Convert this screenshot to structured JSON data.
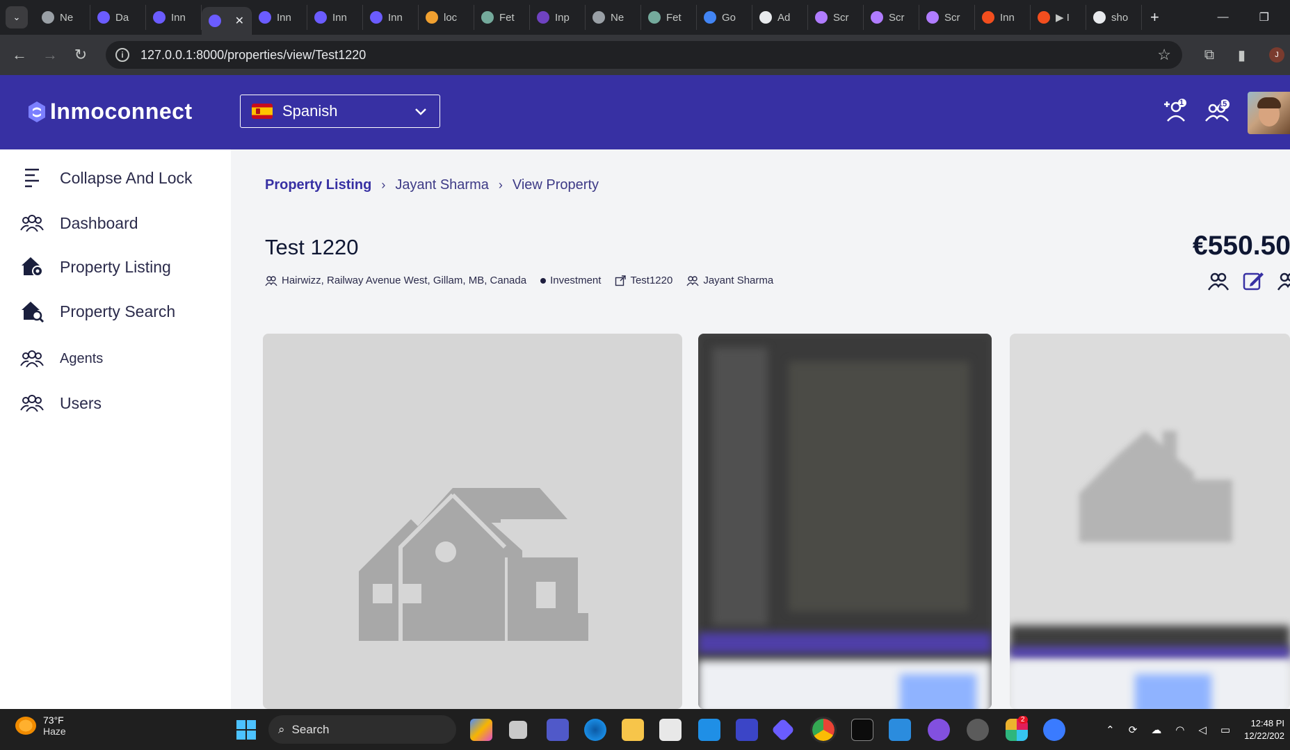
{
  "browser": {
    "tabs": [
      {
        "label": "Ne",
        "color": "#9aa0a6"
      },
      {
        "label": "Da",
        "color": "#6b5cff"
      },
      {
        "label": "Inn",
        "color": "#6b5cff"
      },
      {
        "label": "",
        "color": "#6b5cff",
        "active": true
      },
      {
        "label": "Inn",
        "color": "#6b5cff"
      },
      {
        "label": "Inn",
        "color": "#6b5cff"
      },
      {
        "label": "Inn",
        "color": "#6b5cff"
      },
      {
        "label": "loc",
        "color": "#f0a030"
      },
      {
        "label": "Fet",
        "color": "#74aa9c"
      },
      {
        "label": "Inp",
        "color": "#6f42c1"
      },
      {
        "label": "Ne",
        "color": "#9aa0a6"
      },
      {
        "label": "Fet",
        "color": "#74aa9c"
      },
      {
        "label": "Go",
        "color": "#4285f4"
      },
      {
        "label": "Ad",
        "color": "#e8eaed"
      },
      {
        "label": "Scr",
        "color": "#b07cff"
      },
      {
        "label": "Scr",
        "color": "#b07cff"
      },
      {
        "label": "Scr",
        "color": "#b07cff"
      },
      {
        "label": "Inn",
        "color": "#f24e1e"
      },
      {
        "label": "▶ I",
        "color": "#f24e1e"
      },
      {
        "label": "sho",
        "color": "#e8eaed"
      }
    ],
    "url": "127.0.0.1:8000/properties/view/Test1220",
    "profile_initial": "J"
  },
  "header": {
    "brand": "Inmoconnect",
    "language": "Spanish",
    "agents_badge": "1",
    "team_badge": "15"
  },
  "sidebar": {
    "items": [
      {
        "label": "Collapse And Lock",
        "icon": "collapse-icon"
      },
      {
        "label": "Dashboard",
        "icon": "users-icon"
      },
      {
        "label": "Property Listing",
        "icon": "house-gear-icon"
      },
      {
        "label": "Property Search",
        "icon": "house-search-icon"
      },
      {
        "label": "Agents",
        "icon": "users-icon"
      },
      {
        "label": "Users",
        "icon": "users-icon"
      }
    ]
  },
  "breadcrumb": {
    "items": [
      "Property Listing",
      "Jayant Sharma",
      "View Property"
    ]
  },
  "property": {
    "title": "Test 1220",
    "price": "€550.50",
    "address": "Hairwizz, Railway Avenue West, Gillam, MB, Canada",
    "type": "Investment",
    "reference": "Test1220",
    "agent": "Jayant Sharma"
  },
  "taskbar": {
    "weather_temp": "73°F",
    "weather_desc": "Haze",
    "search_label": "Search",
    "notification_badge": "2",
    "time": "12:48 PI",
    "date": "12/22/202"
  },
  "colors": {
    "brand": "#3730a3",
    "sidebar_text": "#2b2b4b"
  }
}
